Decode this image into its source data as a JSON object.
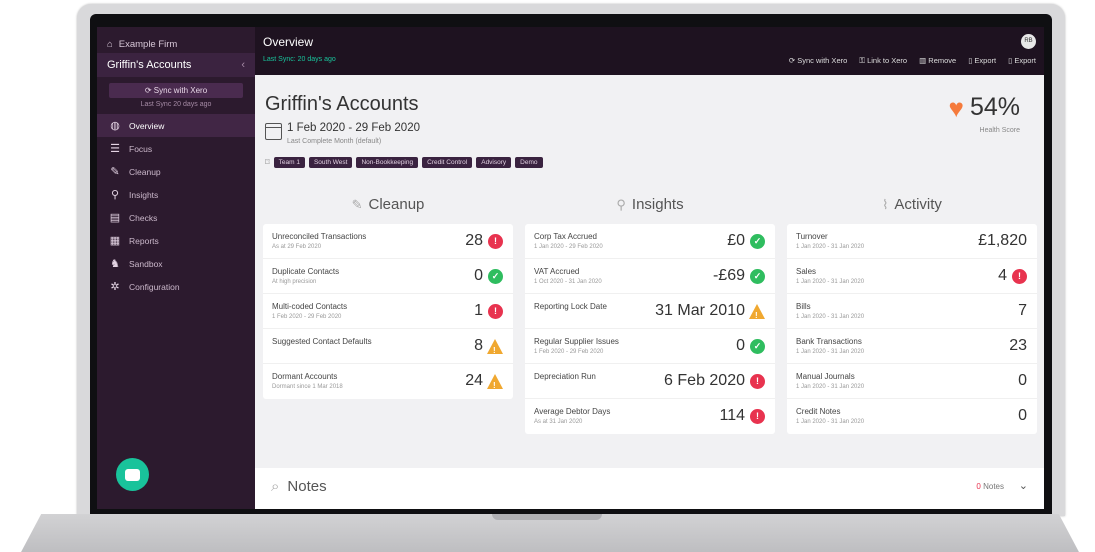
{
  "sidebar": {
    "firm": "Example Firm",
    "client": "Griffin's Accounts",
    "sync_button": "Sync with Xero",
    "sync_sub": "Last Sync 20 days ago",
    "nav": [
      {
        "label": "Overview",
        "icon": "globe-icon",
        "glyph": "◍",
        "active": true
      },
      {
        "label": "Focus",
        "icon": "list-icon",
        "glyph": "☰",
        "active": false
      },
      {
        "label": "Cleanup",
        "icon": "brush-icon",
        "glyph": "✎",
        "active": false
      },
      {
        "label": "Insights",
        "icon": "lightbulb-icon",
        "glyph": "⚲",
        "active": false
      },
      {
        "label": "Checks",
        "icon": "clipboard-icon",
        "glyph": "▤",
        "active": false
      },
      {
        "label": "Reports",
        "icon": "report-icon",
        "glyph": "▦",
        "active": false
      },
      {
        "label": "Sandbox",
        "icon": "sandbox-icon",
        "glyph": "♞",
        "active": false
      },
      {
        "label": "Configuration",
        "icon": "gear-icon",
        "glyph": "✲",
        "active": false
      }
    ]
  },
  "topbar": {
    "title": "Overview",
    "subtitle": "Last Sync: 20 days ago",
    "avatar": "RB",
    "actions": [
      "⟳ Sync with Xero",
      "⚿ Link to Xero",
      "▥ Remove",
      "▯ Export",
      "▯ Export"
    ]
  },
  "client": {
    "name": "Griffin's Accounts",
    "period": "1 Feb 2020 - 29 Feb 2020",
    "period_sub": "Last Complete Month (default)",
    "tags": [
      "Team 1",
      "South West",
      "Non-Bookkeeping",
      "Credit Control",
      "Advisory",
      "Demo"
    ]
  },
  "health": {
    "value": "54%",
    "label": "Health Score",
    "color": "#f57a3b"
  },
  "sections": [
    {
      "title": "Cleanup",
      "icon": "brush-icon",
      "glyph": "✎",
      "rows": [
        {
          "label": "Unreconciled Transactions",
          "sub": "As at 29 Feb 2020",
          "value": "28",
          "status": "red"
        },
        {
          "label": "Duplicate Contacts",
          "sub": "At high precision",
          "value": "0",
          "status": "green"
        },
        {
          "label": "Multi-coded Contacts",
          "sub": "1 Feb 2020 - 29 Feb 2020",
          "value": "1",
          "status": "red"
        },
        {
          "label": "Suggested Contact Defaults",
          "sub": "",
          "value": "8",
          "status": "warn"
        },
        {
          "label": "Dormant Accounts",
          "sub": "Dormant since 1 Mar 2018",
          "value": "24",
          "status": "warn"
        }
      ]
    },
    {
      "title": "Insights",
      "icon": "lightbulb-icon",
      "glyph": "⚲",
      "rows": [
        {
          "label": "Corp Tax Accrued",
          "sub": "1 Jan 2020 - 29 Feb 2020",
          "value": "£0",
          "status": "green"
        },
        {
          "label": "VAT Accrued",
          "sub": "1 Oct 2020 - 31 Jan 2020",
          "value": "-£69",
          "status": "green"
        },
        {
          "label": "Reporting Lock Date",
          "sub": "",
          "value": "31 Mar 2010",
          "status": "warn"
        },
        {
          "label": "Regular Supplier Issues",
          "sub": "1 Feb 2020 - 29 Feb 2020",
          "value": "0",
          "status": "green"
        },
        {
          "label": "Depreciation Run",
          "sub": "",
          "value": "6 Feb 2020",
          "status": "red"
        },
        {
          "label": "Average Debtor Days",
          "sub": "As at 31 Jan 2020",
          "value": "114",
          "status": "red"
        }
      ]
    },
    {
      "title": "Activity",
      "icon": "chart-icon",
      "glyph": "⌇",
      "rows": [
        {
          "label": "Turnover",
          "sub": "1 Jan 2020 - 31 Jan 2020",
          "value": "£1,820",
          "status": "none"
        },
        {
          "label": "Sales",
          "sub": "1 Jan 2020 - 31 Jan 2020",
          "value": "4",
          "status": "red"
        },
        {
          "label": "Bills",
          "sub": "1 Jan 2020 - 31 Jan 2020",
          "value": "7",
          "status": "none"
        },
        {
          "label": "Bank Transactions",
          "sub": "1 Jan 2020 - 31 Jan 2020",
          "value": "23",
          "status": "none"
        },
        {
          "label": "Manual Journals",
          "sub": "1 Jan 2020 - 31 Jan 2020",
          "value": "0",
          "status": "none"
        },
        {
          "label": "Credit Notes",
          "sub": "1 Jan 2020 - 31 Jan 2020",
          "value": "0",
          "status": "none"
        }
      ]
    }
  ],
  "notes": {
    "title": "Notes",
    "count_num": "0",
    "count_label": "Notes"
  },
  "colors": {
    "sidebar": "#2c1a2e",
    "accent": "#19c39b",
    "red": "#e8334f",
    "green": "#2fbd5f",
    "warn": "#f0a830"
  }
}
